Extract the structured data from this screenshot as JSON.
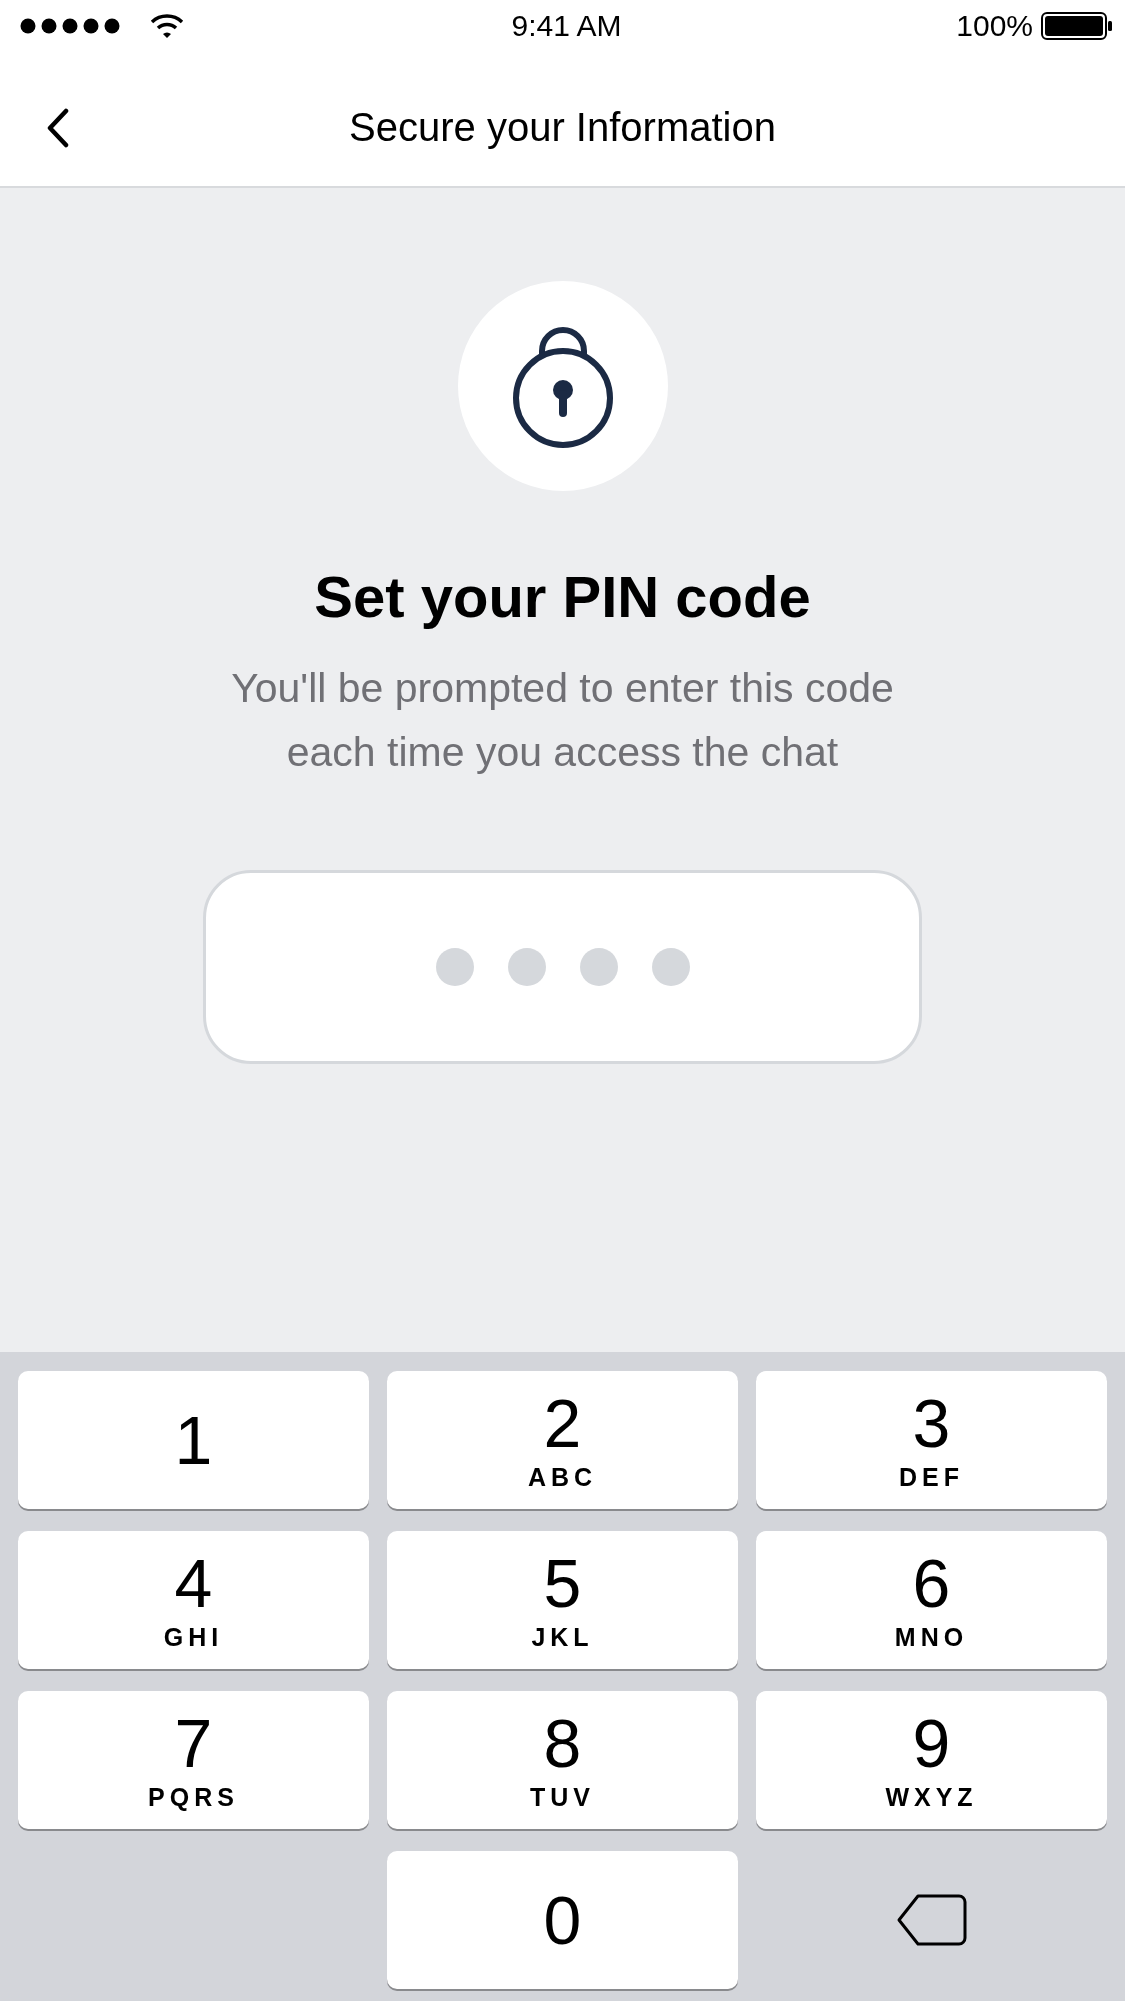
{
  "status_bar": {
    "time": "9:41 AM",
    "battery": "100%"
  },
  "nav": {
    "title": "Secure your Information"
  },
  "heading": "Set your PIN code",
  "subtitle": "You'll be prompted to enter this code each time you access the chat",
  "pin_dots": [
    {
      "filled": false
    },
    {
      "filled": false
    },
    {
      "filled": false
    },
    {
      "filled": false
    }
  ],
  "keypad": [
    {
      "kind": "digit",
      "digit": "1"
    },
    {
      "kind": "digit",
      "digit": "2",
      "letters": "ABC"
    },
    {
      "kind": "digit",
      "digit": "3",
      "letters": "DEF"
    },
    {
      "kind": "digit",
      "digit": "4",
      "letters": "GHI"
    },
    {
      "kind": "digit",
      "digit": "5",
      "letters": "JKL"
    },
    {
      "kind": "digit",
      "digit": "6",
      "letters": "MNO"
    },
    {
      "kind": "digit",
      "digit": "7",
      "letters": "PQRS"
    },
    {
      "kind": "digit",
      "digit": "8",
      "letters": "TUV"
    },
    {
      "kind": "digit",
      "digit": "9",
      "letters": "WXYZ"
    },
    {
      "kind": "blank"
    },
    {
      "kind": "digit",
      "digit": "0"
    },
    {
      "kind": "delete"
    }
  ]
}
